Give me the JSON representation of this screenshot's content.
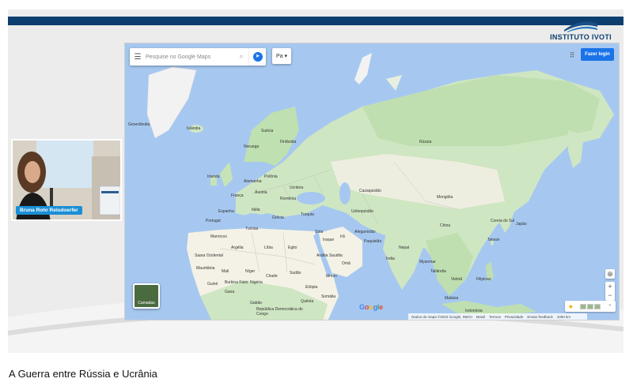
{
  "logo": {
    "text": "INSTITUTO IVOTI",
    "icon": "ship-sail-icon"
  },
  "map": {
    "search_placeholder": "Pesquise no Google Maps",
    "lang": "Pa",
    "login": "Fazer login",
    "layers_label": "Camadas",
    "google": "Google",
    "footer": [
      "Dados do mapa ©2022 Google, INEGI",
      "Brasil",
      "Termos",
      "Privacidade",
      "Enviar feedback",
      "1000 km"
    ],
    "labels": {
      "groenlandia": "Groenlândia",
      "islandia": "Islândia",
      "suecia": "Suécia",
      "noruega": "Noruega",
      "finlandia": "Finlândia",
      "russia": "Rússia",
      "irlanda": "Irlanda",
      "alemanha": "Alemanha",
      "polonia": "Polônia",
      "ucrania": "Ucrânia",
      "franca": "França",
      "austria": "Áustria",
      "romenia": "Romênia",
      "espanha": "Espanha",
      "portugal": "Portugal",
      "italia": "Itália",
      "grecia": "Grécia",
      "turquia": "Turquia",
      "cazaquistao": "Cazaquistão",
      "mongolia": "Mongólia",
      "usbequistao": "Uzbequistão",
      "china": "China",
      "japao": "Japão",
      "coreia": "Coreia do Sul",
      "marrocos": "Marrocos",
      "argelia": "Argélia",
      "libia": "Líbia",
      "egito": "Egito",
      "iraque": "Iraque",
      "ira": "Irã",
      "afeganistao": "Afeganistão",
      "paquistao": "Paquistão",
      "siria": "Síria",
      "arabia": "Arábia Saudita",
      "oma": "Omã",
      "iemen": "Iêmen",
      "india": "Índia",
      "nepal": "Nepal",
      "mianmar": "Myanmar",
      "tailandia": "Tailândia",
      "vietna": "Vietnã",
      "filipinas": "Filipinas",
      "tunisia": "Tunísia",
      "saara": "Saara Ocidental",
      "mauritania": "Mauritânia",
      "mali": "Mali",
      "niger": "Níger",
      "chade": "Chade",
      "sudao": "Sudão",
      "etiopia": "Etiópia",
      "nigeria": "Nigéria",
      "gana": "Gana",
      "guine": "Guiné",
      "burkina": "Burkina Faso",
      "somalia": "Somália",
      "quenia": "Quênia",
      "gabao": "Gabão",
      "rdc": "República Democrática do Congo",
      "malasia": "Malásia",
      "indonesia": "Indonésia",
      "taiwan": "Taiwan"
    }
  },
  "presenter": {
    "name": "Bruna Rohr Reisdoerfer"
  },
  "video_title": "A Guerra entre Rússia e Ucrânia"
}
